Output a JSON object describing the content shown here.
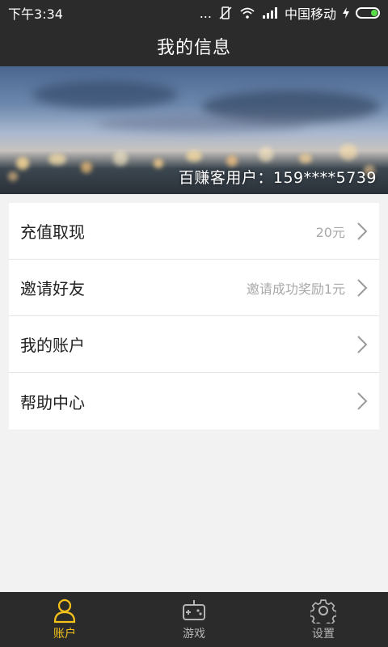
{
  "status_bar": {
    "time": "下午3:34",
    "dots": "...",
    "carrier": "中国移动"
  },
  "header": {
    "title": "我的信息"
  },
  "banner": {
    "user_text": "百赚客用户：159****5739"
  },
  "menu": [
    {
      "label": "充值取现",
      "value": "20元"
    },
    {
      "label": "邀请好友",
      "value": "邀请成功奖励1元"
    },
    {
      "label": "我的账户",
      "value": ""
    },
    {
      "label": "帮助中心",
      "value": ""
    }
  ],
  "bottom_nav": {
    "active_color": "#f6c21a",
    "tabs": [
      {
        "label": "账户",
        "icon": "person-icon",
        "active": true
      },
      {
        "label": "游戏",
        "icon": "gamepad-icon",
        "active": false
      },
      {
        "label": "设置",
        "icon": "gear-icon",
        "active": false
      }
    ]
  }
}
